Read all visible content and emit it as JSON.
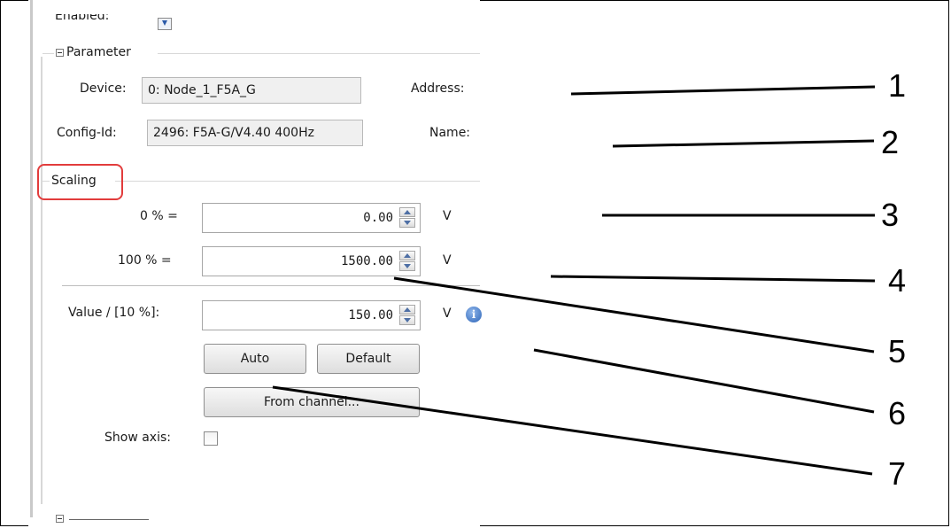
{
  "enabled": {
    "label": "Enabled:"
  },
  "parameter": {
    "group_title": "Parameter",
    "device_label": "Device:",
    "device_value": "0: Node_1_F5A_G",
    "address_label": "Address:",
    "config_label": "Config-Id:",
    "config_value": "2496: F5A-G/V4.40 400Hz",
    "name_label": "Name:"
  },
  "scaling": {
    "group_title": "Scaling",
    "zero_label": "0 % =",
    "zero_value": "0.00",
    "zero_unit": "V",
    "hundred_label": "100 % =",
    "hundred_value": "1500.00",
    "hundred_unit": "V",
    "value_label": "Value / [10 %]:",
    "value_value": "150.00",
    "value_unit": "V",
    "auto_button": "Auto",
    "default_button": "Default",
    "from_channel_button": "From channel...",
    "show_axis_label": "Show axis:",
    "show_axis_checked": false
  },
  "callouts": [
    "1",
    "2",
    "3",
    "4",
    "5",
    "6",
    "7"
  ],
  "colors": {
    "highlight": "#e23c3c",
    "spin_arrow": "#4e6fa5",
    "info": "#2c64b8"
  },
  "icons": [
    "collapse-minus-icon",
    "spin-up-icon",
    "spin-down-icon",
    "info-icon",
    "dropdown-arrow-icon"
  ]
}
